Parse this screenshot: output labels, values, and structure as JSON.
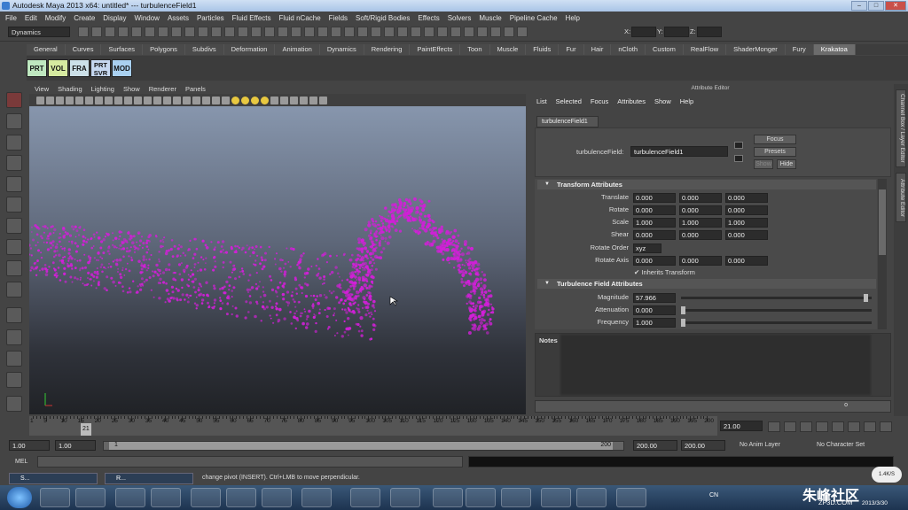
{
  "window": {
    "title": "Autodesk Maya 2013 x64: untitled*   ---   turbulenceField1",
    "min": "–",
    "max": "□",
    "close": "✕"
  },
  "menubar": [
    "File",
    "Edit",
    "Modify",
    "Create",
    "Display",
    "Window",
    "Assets",
    "Particles",
    "Fluid Effects",
    "Fluid nCache",
    "Fields",
    "Soft/Rigid Bodies",
    "Effects",
    "Solvers",
    "Muscle",
    "Pipeline Cache",
    "Help"
  ],
  "status": {
    "mode": "Dynamics",
    "x_label": "X:",
    "y_label": "Y:",
    "z_label": "Z:"
  },
  "shelf_tabs": [
    "General",
    "Curves",
    "Surfaces",
    "Polygons",
    "Subdivs",
    "Deformation",
    "Animation",
    "Dynamics",
    "Rendering",
    "PaintEffects",
    "Toon",
    "Muscle",
    "Fluids",
    "Fur",
    "Hair",
    "nCloth",
    "Custom",
    "RealFlow",
    "ShaderMonger",
    "Fury",
    "Krakatoa"
  ],
  "shelf_active": "Krakatoa",
  "krakatoa_buttons": [
    {
      "label": "PRT",
      "color": "#bfe8c0"
    },
    {
      "label": "VOL",
      "color": "#d6eaa0"
    },
    {
      "label": "FRA",
      "color": "#cce0e8"
    },
    {
      "label": "PRT SVR",
      "color": "#c6d8f0"
    },
    {
      "label": "MOD",
      "color": "#a9d0f0"
    }
  ],
  "viewport_menu": [
    "View",
    "Shading",
    "Lighting",
    "Show",
    "Renderer",
    "Panels"
  ],
  "attribute_editor": {
    "title": "Attribute Editor",
    "menu": [
      "List",
      "Selected",
      "Focus",
      "Attributes",
      "Show",
      "Help"
    ],
    "tab": "turbulenceField1",
    "node_label": "turbulenceField:",
    "node_value": "turbulenceField1",
    "buttons": {
      "focus": "Focus",
      "presets": "Presets",
      "show": "Show",
      "hide": "Hide"
    },
    "transform_section": "Transform Attributes",
    "transform_rows": [
      {
        "label": "Translate",
        "values": [
          "0.000",
          "0.000",
          "0.000"
        ]
      },
      {
        "label": "Rotate",
        "values": [
          "0.000",
          "0.000",
          "0.000"
        ]
      },
      {
        "label": "Scale",
        "values": [
          "1.000",
          "1.000",
          "1.000"
        ]
      },
      {
        "label": "Shear",
        "values": [
          "0.000",
          "0.000",
          "0.000"
        ]
      }
    ],
    "rotate_order_label": "Rotate Order",
    "rotate_order_value": "xyz",
    "rotate_axis_label": "Rotate Axis",
    "rotate_axis_values": [
      "0.000",
      "0.000",
      "0.000"
    ],
    "inherits_transform": "Inherits Transform",
    "turbulence_section": "Turbulence Field Attributes",
    "turbulence_rows": [
      {
        "label": "Magnitude",
        "value": "57.966",
        "slider": 0.97
      },
      {
        "label": "Attenuation",
        "value": "0.000",
        "slider": 0.0
      },
      {
        "label": "Frequency",
        "value": "1.000",
        "slider": 0.0
      }
    ],
    "notes_label": "Notes",
    "notes_tail": "o"
  },
  "side_tabs": [
    "Channel Box / Layer Editor",
    "Attribute Editor"
  ],
  "timeline": {
    "ticks": [
      "1",
      "5",
      "10",
      "15",
      "20",
      "25",
      "30",
      "35",
      "40",
      "45",
      "50",
      "55",
      "60",
      "65",
      "70",
      "75",
      "80",
      "85",
      "90",
      "95",
      "100",
      "105",
      "110",
      "115",
      "120",
      "125",
      "130",
      "135",
      "140",
      "145",
      "150",
      "155",
      "160",
      "165",
      "170",
      "175",
      "180",
      "185",
      "190",
      "195",
      "200"
    ],
    "current": "21",
    "current_frame_field": "21.00"
  },
  "range": {
    "start": "1.00",
    "start2": "1.00",
    "range_left": "1",
    "range_right": "200",
    "end": "200.00",
    "end2": "200.00",
    "anim_layer": "No Anim Layer",
    "char_set": "No Character Set"
  },
  "mel": {
    "label": "MEL"
  },
  "helpline": "change pivot (INSERT). Ctrl+LMB to move perpendicular.",
  "taskbar": {
    "app1": "S...",
    "app2": "R...",
    "lang": "CN",
    "clock": "2013/3/30",
    "badge": "1.4K/S",
    "watermark": "朱峰社区",
    "watermark_sub": "ZF3D.COM"
  }
}
